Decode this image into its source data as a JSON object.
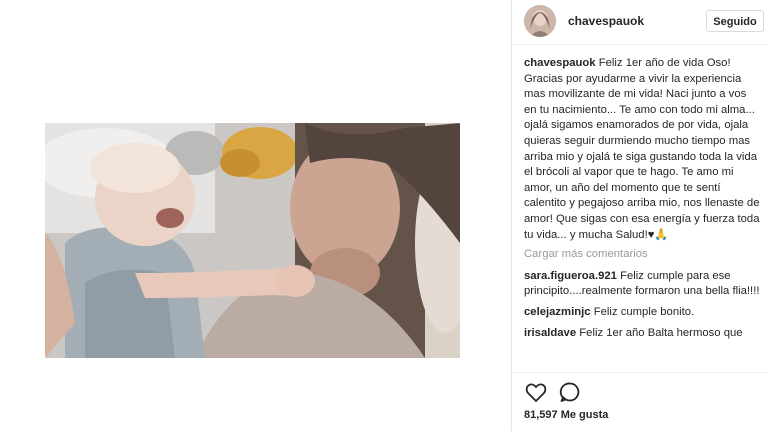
{
  "post": {
    "username": "chavespauok",
    "follow_label": "Seguido",
    "caption_user": "chavespauok",
    "caption_text": "Feliz 1er año de vida Oso! Gracias por ayudarme a vivir la experiencia mas movilizante de mi vida! Naci junto a vos en tu nacimiento... Te amo con todo mi alma... ojalá sigamos enamorados de por vida, ojala quieras seguir durmiendo mucho tiempo mas arriba mio y ojalá te siga gustando toda la vida el brócoli al vapor que te hago. Te amo mi amor, un año del momento que te sentí calentito y pegajoso arriba mio, nos llenaste de amor! Que sigas con esa energía y fuerza toda tu vida... y mucha Salud!♥🙏",
    "load_more": "Cargar más comentarios",
    "comments": [
      {
        "user": "sara.figueroa.921",
        "text": "Feliz cumple para ese principito....realmente formaron una bella flia!!!!"
      },
      {
        "user": "celejazminjc",
        "text": "Feliz cumple bonito."
      },
      {
        "user": "irisaldave",
        "text": "Feliz 1er año Balta hermoso que"
      }
    ],
    "likes_count": "81,597",
    "likes_label": "Me gusta"
  },
  "icons": {
    "like": "heart-icon",
    "comment": "comment-bubble-icon"
  }
}
